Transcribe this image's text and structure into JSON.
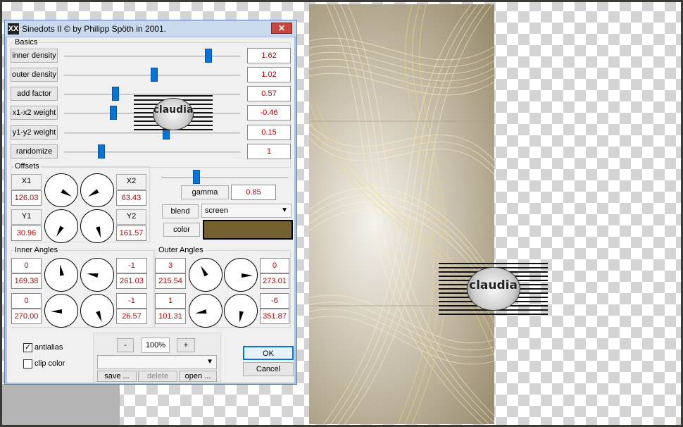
{
  "dialog": {
    "title": "Sinedots II © by Philipp Spöth in 2001.",
    "app_icon": "XX",
    "close_label": "✕"
  },
  "basics": {
    "label": "Basics",
    "rows": [
      {
        "name": "inner density",
        "value": "1.62",
        "position": 0.82
      },
      {
        "name": "outer density",
        "value": "1.02",
        "position": 0.51
      },
      {
        "name": "add factor",
        "value": "0.57",
        "position": 0.29
      },
      {
        "name": "x1-x2 weight",
        "value": "-0.46",
        "position": 0.28
      },
      {
        "name": "y1-y2 weight",
        "value": "0.15",
        "position": 0.58
      },
      {
        "name": "randomize",
        "value": "1",
        "position": 0.21
      }
    ]
  },
  "offsets": {
    "label": "Offsets",
    "x1_label": "X1",
    "x1_value": "126.03",
    "x2_label": "X2",
    "x2_value": "63.43",
    "y1_label": "Y1",
    "y1_value": "30.96",
    "y2_label": "Y2",
    "y2_value": "161.57"
  },
  "gamma": {
    "label": "gamma",
    "value": "0.85",
    "position": 0.28
  },
  "blend": {
    "label": "blend",
    "value": "screen"
  },
  "color": {
    "label": "color",
    "swatch": "#75602f"
  },
  "inner_angles": {
    "label": "Inner Angles",
    "top_left": "0",
    "top_left_angle": "169.38",
    "top_right": "-1",
    "top_right_angle": "261.03",
    "bottom_left": "0",
    "bottom_left_angle": "270.00",
    "bottom_right": "-1",
    "bottom_right_angle": "26.57"
  },
  "outer_angles": {
    "label": "Outer Angles",
    "top_left": "3",
    "top_left_angle": "215.54",
    "top_right": "0",
    "top_right_angle": "273.01",
    "bottom_left": "1",
    "bottom_left_angle": "101.31",
    "bottom_right": "-6",
    "bottom_right_angle": "351.87"
  },
  "options": {
    "antialias_label": "antialias",
    "antialias_checked": true,
    "clip_color_label": "clip color",
    "clip_color_checked": false
  },
  "zoom": {
    "minus": "-",
    "value": "100%",
    "plus": "+"
  },
  "presets": {
    "save": "save ...",
    "delete": "delete",
    "open": "open ..."
  },
  "actions": {
    "ok": "OK",
    "cancel": "Cancel"
  },
  "watermark": {
    "text": "claudia"
  },
  "colors": {
    "accent": "#0a74d6",
    "value_text": "#c00000"
  }
}
